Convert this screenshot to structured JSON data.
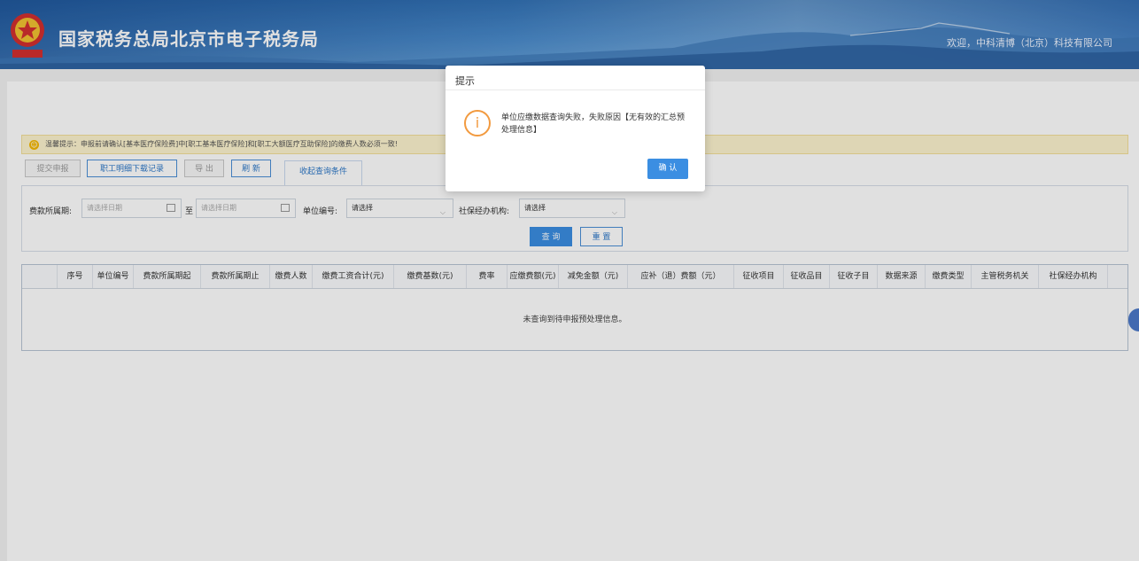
{
  "header": {
    "title": "国家税务总局北京市电子税务局",
    "welcome": "欢迎，中科清博（北京）科技有限公司"
  },
  "tip": {
    "text": "温馨提示：申报前请确认[基本医疗保险费]中[职工基本医疗保险]和[职工大额医疗互助保险]的缴费人数必须一致!"
  },
  "toolbar": {
    "submit": "提交申报",
    "download": "职工明细下载记录",
    "export": "导 出",
    "refresh": "刷 新",
    "collapse": "收起查询条件"
  },
  "filters": {
    "period_label": "费款所属期:",
    "date_placeholder": "请选择日期",
    "to": "至",
    "unit_label": "单位编号:",
    "unit_value": "请选择",
    "agency_label": "社保经办机构:",
    "agency_value": "请选择",
    "query": "查 询",
    "reset": "重 置"
  },
  "table": {
    "columns": [
      "序号",
      "单位编号",
      "费款所属期起",
      "费款所属期止",
      "缴费人数",
      "缴费工资合计(元)",
      "缴费基数(元)",
      "费率",
      "应缴费额(元)",
      "减免金额（元)",
      "应补（退）费额（元）",
      "征收项目",
      "征收品目",
      "征收子目",
      "数据来源",
      "缴费类型",
      "主管税务机关",
      "社保经办机构"
    ],
    "empty": "未查询到待申报预处理信息。"
  },
  "dialog": {
    "title": "提示",
    "message": "单位应缴数据查询失败，失败原因【无有效的汇总预处理信息】",
    "ok": "确 认"
  },
  "colors": {
    "primary": "#3b8ee2",
    "warning": "#f29a3f"
  }
}
